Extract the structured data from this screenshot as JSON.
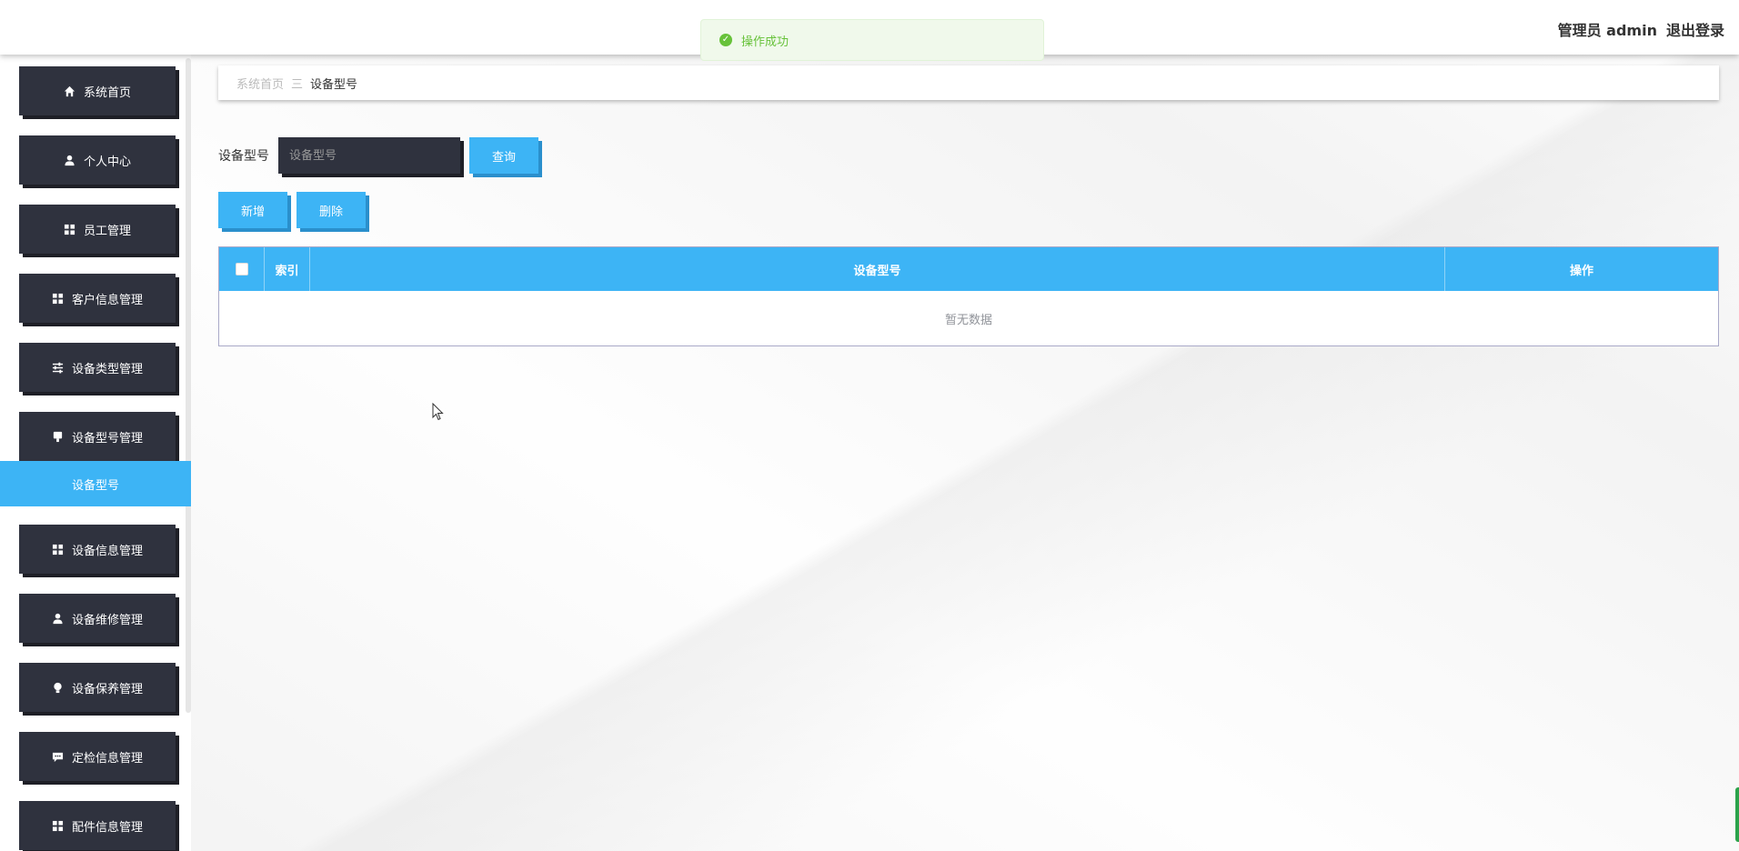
{
  "header": {
    "user_label": "管理员 admin",
    "logout_label": "退出登录"
  },
  "toast": {
    "message": "操作成功"
  },
  "sidebar": {
    "items": [
      {
        "label": "系统首页",
        "icon": "home-icon"
      },
      {
        "label": "个人中心",
        "icon": "user-icon"
      },
      {
        "label": "员工管理",
        "icon": "grid-icon"
      },
      {
        "label": "客户信息管理",
        "icon": "grid-icon"
      },
      {
        "label": "设备类型管理",
        "icon": "sliders-icon"
      },
      {
        "label": "设备型号管理",
        "icon": "device-icon"
      },
      {
        "label": "设备信息管理",
        "icon": "grid-icon"
      },
      {
        "label": "设备维修管理",
        "icon": "user-icon"
      },
      {
        "label": "设备保养管理",
        "icon": "bulb-icon"
      },
      {
        "label": "定检信息管理",
        "icon": "chat-icon"
      },
      {
        "label": "配件信息管理",
        "icon": "grid-icon"
      }
    ],
    "active_submenu": "设备型号"
  },
  "breadcrumb": {
    "home": "系统首页",
    "separator": "三",
    "current": "设备型号"
  },
  "search": {
    "label": "设备型号",
    "placeholder": "设备型号",
    "query_button": "查询"
  },
  "actions": {
    "add_label": "新增",
    "delete_label": "删除"
  },
  "table": {
    "columns": [
      "索引",
      "设备型号",
      "操作"
    ],
    "empty_text": "暂无数据"
  },
  "colors": {
    "accent": "#3db4f5",
    "sidebar_item_bg": "#2f323e",
    "success": "#67c23a"
  }
}
